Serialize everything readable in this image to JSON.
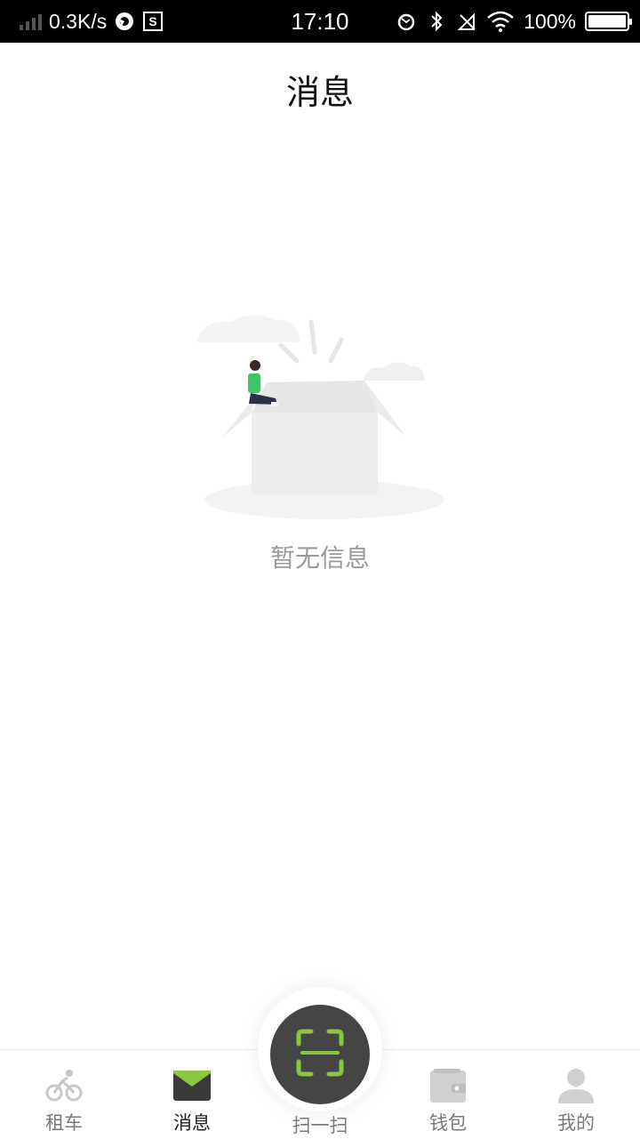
{
  "status_bar": {
    "net_speed": "0.3K/s",
    "time": "17:10",
    "battery": "100%"
  },
  "header": {
    "title": "消息"
  },
  "empty_state": {
    "message": "暂无信息"
  },
  "tabs": [
    {
      "label": "租车",
      "icon": "bike-icon",
      "active": false
    },
    {
      "label": "消息",
      "icon": "envelope-icon",
      "active": true
    },
    {
      "label": "扫一扫",
      "icon": "scan-icon",
      "active": false
    },
    {
      "label": "钱包",
      "icon": "wallet-icon",
      "active": false
    },
    {
      "label": "我的",
      "icon": "person-icon",
      "active": false
    }
  ],
  "colors": {
    "accent": "#8cc63f",
    "scan_button": "#454545",
    "inactive_tab": "#7a7a7a",
    "active_tab": "#222222"
  }
}
